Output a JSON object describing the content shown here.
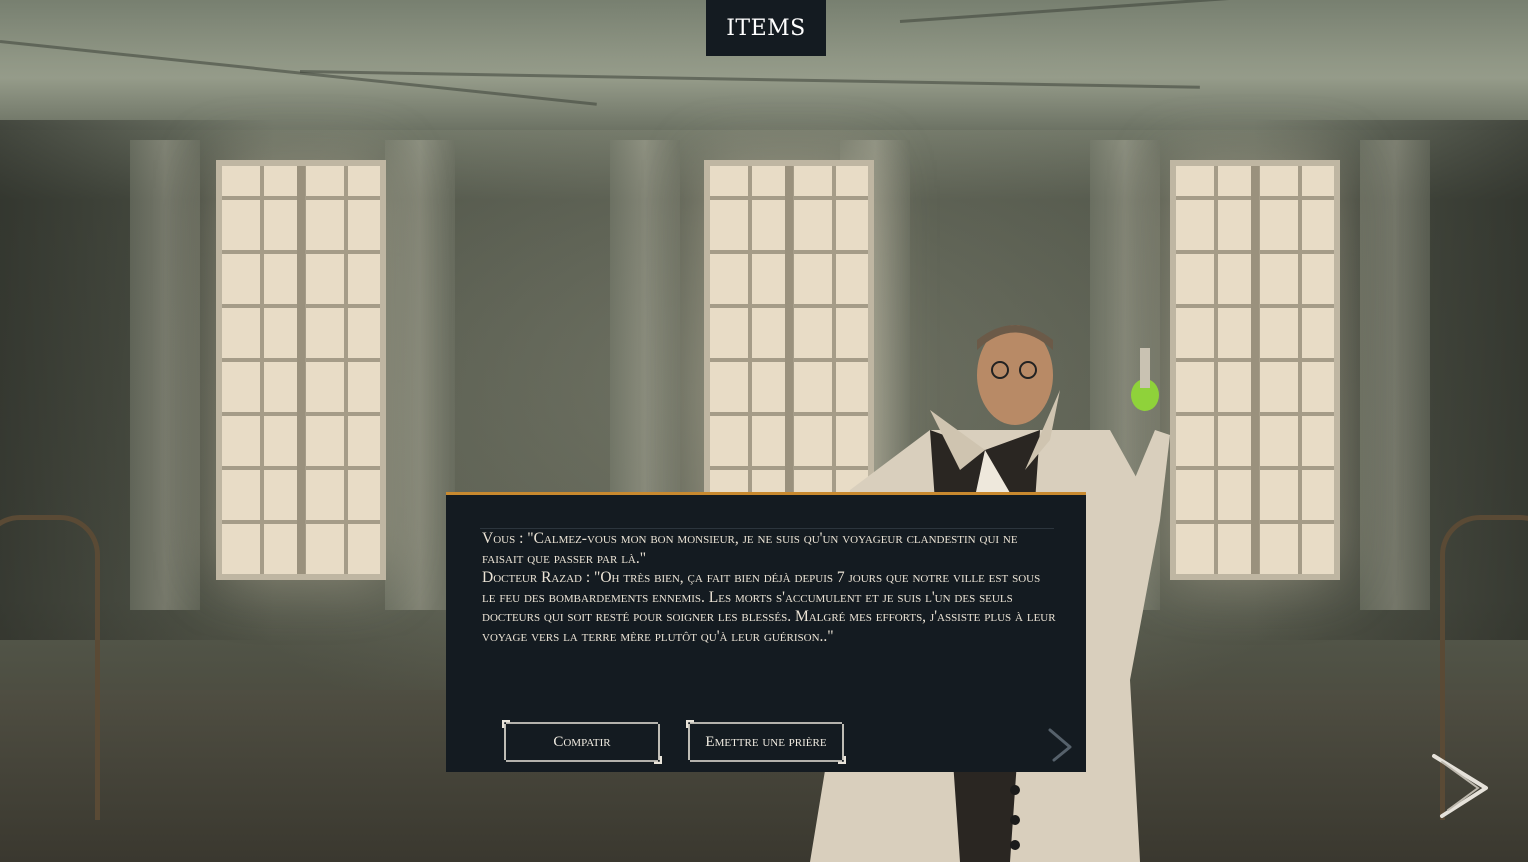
{
  "header": {
    "items_tab_label": "ITEMS"
  },
  "dialog": {
    "lines": [
      "Vous : \"Calmez-vous mon bon monsieur, je ne suis qu'un voyageur clandestin qui ne faisait que passer par là.\"",
      "Docteur Razad : \"Oh très bien, ça fait bien déjà depuis 7 jours que notre ville est sous le feu des bombardements ennemis. Les morts s'accumulent et je suis l'un des seuls docteurs qui soit resté pour soigner les blessés. Malgré mes efforts, j'assiste plus à leur voyage vers la terre mère plutôt qu'à leur guérison..\""
    ],
    "choices": [
      "Compatir",
      "Emettre une prière"
    ]
  },
  "icons": {
    "dialog_next": "chevron-right-icon",
    "scene_next": "chevron-right-icon"
  },
  "colors": {
    "panel": "#141b21",
    "accent": "#c8892f",
    "text": "#ece4d6"
  }
}
